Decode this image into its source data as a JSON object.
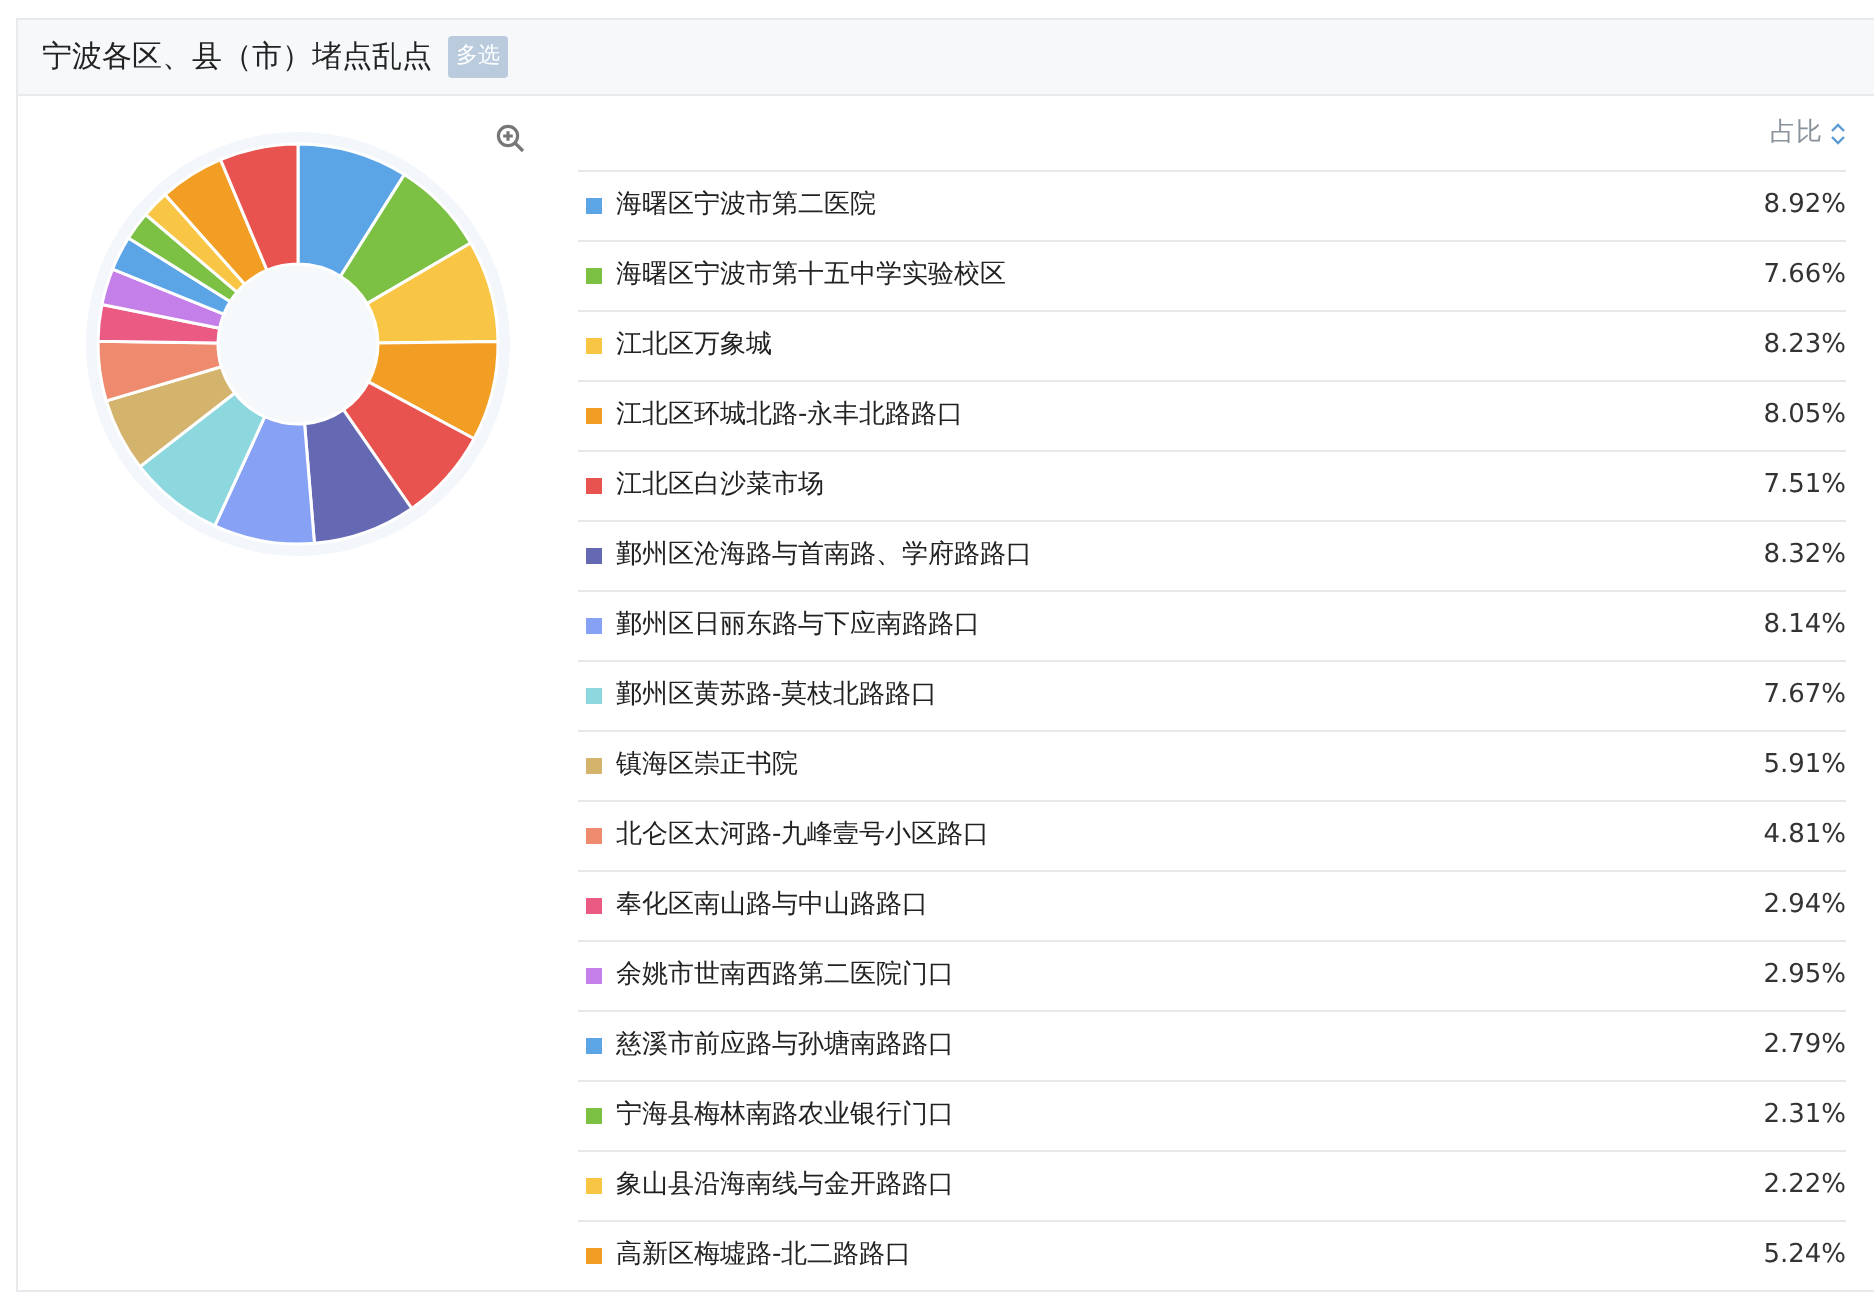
{
  "panel": {
    "title": "宁波各区、县（市）堵点乱点",
    "tag": "多选"
  },
  "table": {
    "columns": [
      "占比"
    ],
    "rows": [
      {
        "name": "海曙区宁波市第二医院",
        "share": "8.92%",
        "color": "#5ba5e6"
      },
      {
        "name": "海曙区宁波市第十五中学实验校区",
        "share": "7.66%",
        "color": "#7cc144"
      },
      {
        "name": "江北区万象城",
        "share": "8.23%",
        "color": "#f8c545"
      },
      {
        "name": "江北区环城北路-永丰北路路口",
        "share": "8.05%",
        "color": "#f29d24"
      },
      {
        "name": "江北区白沙菜市场",
        "share": "7.51%",
        "color": "#e8534f"
      },
      {
        "name": "鄞州区沧海路与首南路、学府路路口",
        "share": "8.32%",
        "color": "#6569b3"
      },
      {
        "name": "鄞州区日丽东路与下应南路路口",
        "share": "8.14%",
        "color": "#87a2f5"
      },
      {
        "name": "鄞州区黄苏路-莫枝北路路口",
        "share": "7.67%",
        "color": "#8dd7de"
      },
      {
        "name": "镇海区崇正书院",
        "share": "5.91%",
        "color": "#d4b36c"
      },
      {
        "name": "北仑区太河路-九峰壹号小区路口",
        "share": "4.81%",
        "color": "#ee8a6d"
      },
      {
        "name": "奉化区南山路与中山路路口",
        "share": "2.94%",
        "color": "#ea5a82"
      },
      {
        "name": "余姚市世南西路第二医院门口",
        "share": "2.95%",
        "color": "#c57fe8"
      },
      {
        "name": "慈溪市前应路与孙塘南路路口",
        "share": "2.79%",
        "color": "#5ba5e6"
      },
      {
        "name": "宁海县梅林南路农业银行门口",
        "share": "2.31%",
        "color": "#7cc144"
      },
      {
        "name": "象山县沿海南线与金开路路口",
        "share": "2.22%",
        "color": "#f8c545"
      },
      {
        "name": "高新区梅墟路-北二路路口",
        "share": "5.24%",
        "color": "#f29d24"
      }
    ]
  }
}
